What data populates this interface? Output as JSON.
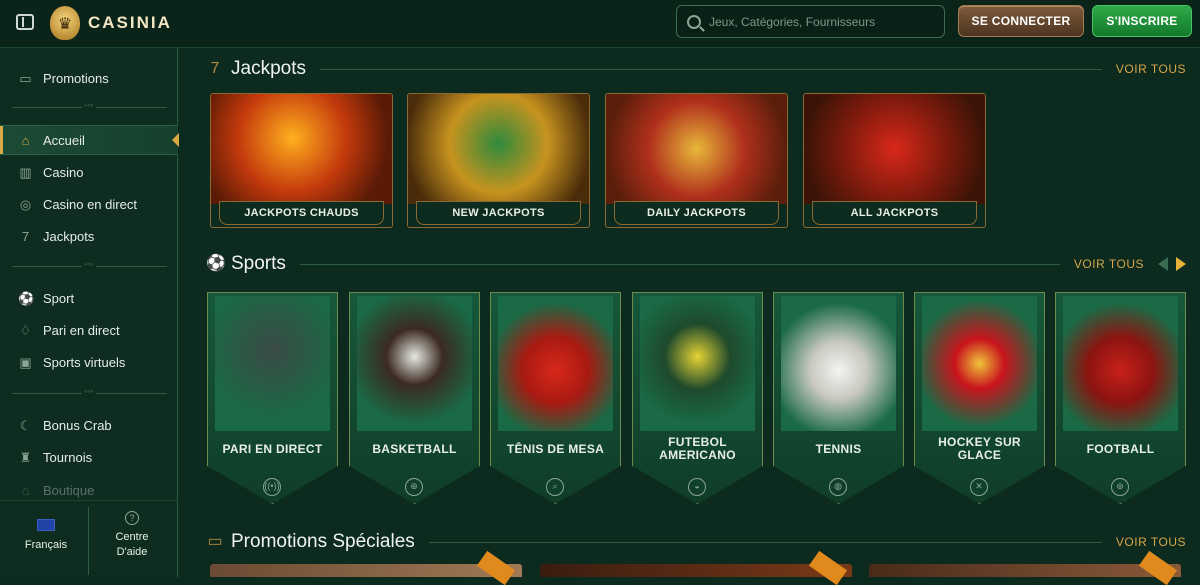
{
  "brand": {
    "name": "CASINIA"
  },
  "header": {
    "search_placeholder": "Jeux, Catégories, Fournisseurs",
    "login_label": "SE CONNECTER",
    "signup_label": "S'INSCRIRE"
  },
  "sidebar": {
    "items": [
      {
        "label": "Promotions",
        "icon": "gift-icon"
      },
      {
        "label": "Accueil",
        "icon": "home-icon",
        "active": true
      },
      {
        "label": "Casino",
        "icon": "casino-icon"
      },
      {
        "label": "Casino en direct",
        "icon": "chip-icon"
      },
      {
        "label": "Jackpots",
        "icon": "seven-icon"
      },
      {
        "label": "Sport",
        "icon": "ball-icon"
      },
      {
        "label": "Pari en direct",
        "icon": "live-icon"
      },
      {
        "label": "Sports virtuels",
        "icon": "gamepad-icon"
      },
      {
        "label": "Bonus Crab",
        "icon": "crab-icon"
      },
      {
        "label": "Tournois",
        "icon": "trophy-icon"
      },
      {
        "label": "Boutique",
        "icon": "shop-icon"
      }
    ],
    "language": "Français",
    "help_line1": "Centre",
    "help_line2": "D'aide"
  },
  "sections": {
    "jackpots": {
      "title": "Jackpots",
      "see_all": "VOIR TOUS",
      "cards": [
        "JACKPOTS CHAUDS",
        "NEW JACKPOTS",
        "DAILY JACKPOTS",
        "ALL JACKPOTS"
      ]
    },
    "sports": {
      "title": "Sports",
      "see_all": "VOIR TOUS",
      "cards": [
        {
          "line1": "PARI EN DIRECT",
          "line2": ""
        },
        {
          "line1": "BASKETBALL",
          "line2": ""
        },
        {
          "line1": "TÊNIS DE MESA",
          "line2": ""
        },
        {
          "line1": "FUTEBOL",
          "line2": "AMERICANO"
        },
        {
          "line1": "TENNIS",
          "line2": ""
        },
        {
          "line1": "HOCKEY SUR",
          "line2": "GLACE"
        },
        {
          "line1": "FOOTBALL",
          "line2": ""
        }
      ]
    },
    "promotions": {
      "title": "Promotions Spéciales",
      "see_all": "VOIR TOUS"
    }
  },
  "colors": {
    "background": "#0c2a1e",
    "accent_gold": "#d6a64b",
    "signup_green": "#2fa948",
    "login_brown": "#7d5a3b"
  }
}
